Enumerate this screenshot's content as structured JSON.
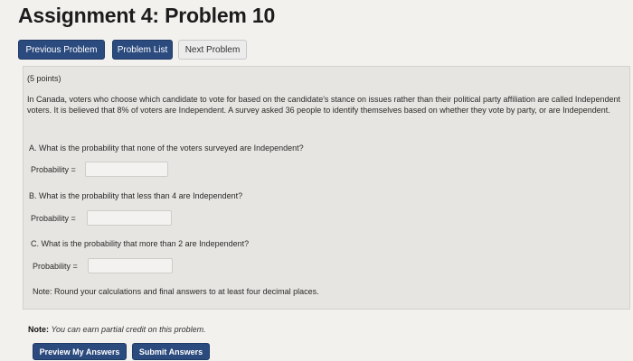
{
  "page_title": "Assignment 4: Problem 10",
  "nav": {
    "previous": "Previous Problem",
    "list": "Problem List",
    "next": "Next Problem"
  },
  "problem": {
    "points": "(5 points)",
    "intro": "In Canada, voters who choose which candidate to vote for based on the candidate's stance on issues rather than their political party affiliation are called Independent voters. It is believed that 8% of voters are Independent. A survey asked 36 people to identify themselves based on whether they vote by party, or are Independent.",
    "parts": [
      {
        "question": "A. What is the probability that none of the voters surveyed are Independent?",
        "label": "Probability =",
        "value": ""
      },
      {
        "question": "B. What is the probability that less than 4 are Independent?",
        "label": "Probability =",
        "value": ""
      },
      {
        "question": "C. What is the probability that more than 2 are Independent?",
        "label": "Probability =",
        "value": ""
      }
    ],
    "note": "Note: Round your calculations and final answers to at least four decimal places."
  },
  "footer": {
    "note_label": "Note:",
    "note_text": "You can earn partial credit on this problem.",
    "preview_button": "Preview My Answers",
    "submit_button": "Submit Answers"
  },
  "colors": {
    "primary_button": "#2b4a7e",
    "secondary_button": "#ececec",
    "problem_background": "#e6e5e1",
    "page_background": "#f2f1ee"
  }
}
